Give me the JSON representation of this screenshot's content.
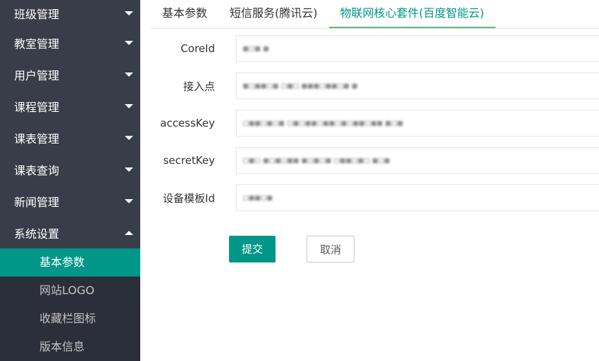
{
  "sidebar": {
    "items": [
      {
        "label": "班级管理"
      },
      {
        "label": "教室管理"
      },
      {
        "label": "用户管理"
      },
      {
        "label": "课程管理"
      },
      {
        "label": "课表管理"
      },
      {
        "label": "课表查询"
      },
      {
        "label": "新闻管理"
      },
      {
        "label": "系统设置"
      }
    ],
    "subitems": [
      {
        "label": "基本参数"
      },
      {
        "label": "网站LOGO"
      },
      {
        "label": "收藏栏图标"
      },
      {
        "label": "版本信息"
      }
    ]
  },
  "tabs": [
    {
      "label": "基本参数"
    },
    {
      "label": "短信服务(腾讯云)"
    },
    {
      "label": "物联网核心套件(百度智能云)"
    }
  ],
  "form": {
    "fields": [
      {
        "label": "CoreId",
        "value": "▪▫▪ ▪"
      },
      {
        "label": "接入点",
        "value": "▪▫▪▪▫▪ ▫▪▫ ▪▪▪▫▪▪▫▪ ▪"
      },
      {
        "label": "accessKey",
        "value": "▫▪▪▫▪▫▪ ▫▪▫▪▪▫▪▪▫▪▫▪▪▫▪▪ ▪▫▪"
      },
      {
        "label": "secretKey",
        "value": "▫▪▫ ▪▫▪▫▪▪ ▪▫▪▫▪ ▫▪▪▫▪▫ ▪▫▪"
      },
      {
        "label": "设备模板Id",
        "value": "▫▪▪▫▪"
      }
    ],
    "submit_label": "提交",
    "cancel_label": "取消"
  }
}
